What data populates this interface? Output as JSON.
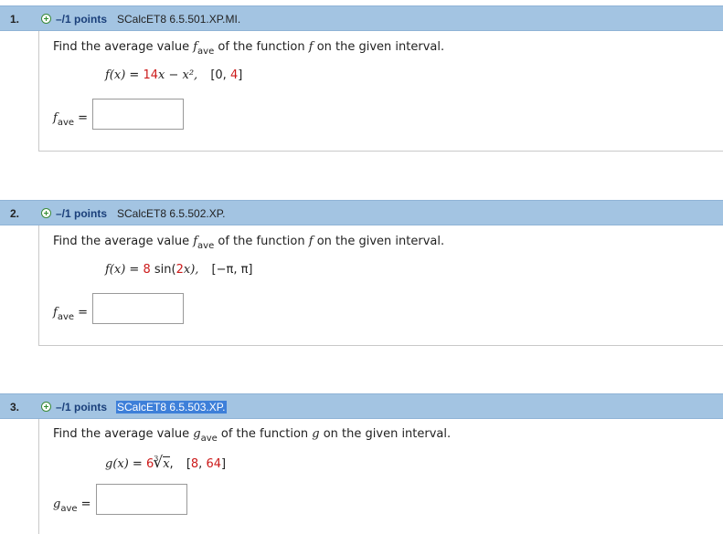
{
  "questions": [
    {
      "number": "1.",
      "points": "–/1 points",
      "ref": "SCalcET8 6.5.501.XP.MI.",
      "prompt_pre": "Find the average value ",
      "avg_var": "f",
      "avg_sub": "ave",
      "prompt_mid": " of the function ",
      "func_var": "f",
      "prompt_post": " on the given interval.",
      "formula_lhs": "f(x)",
      "formula_eq": " = ",
      "formula_rhs_a": "14",
      "formula_rhs_b": "x − x²,",
      "interval_open": "[0, ",
      "interval_val": "4",
      "interval_close": "]",
      "answer_label_var": "f",
      "answer_label_sub": "ave",
      "answer_eq": " =",
      "answer_value": ""
    },
    {
      "number": "2.",
      "points": "–/1 points",
      "ref": "SCalcET8 6.5.502.XP.",
      "prompt_pre": "Find the average value ",
      "avg_var": "f",
      "avg_sub": "ave",
      "prompt_mid": " of the function ",
      "func_var": "f",
      "prompt_post": " on the given interval.",
      "formula_lhs": "f(x)",
      "formula_eq": " = ",
      "formula_rhs_a": "8",
      "formula_rhs_b": " sin(",
      "formula_rhs_c": "2",
      "formula_rhs_d": "x),",
      "interval": "[−π, π]",
      "answer_label_var": "f",
      "answer_label_sub": "ave",
      "answer_eq": " =",
      "answer_value": ""
    },
    {
      "number": "3.",
      "points": "–/1 points",
      "ref": "SCalcET8 6.5.503.XP.",
      "prompt_pre": "Find the average value ",
      "avg_var": "g",
      "avg_sub": "ave",
      "prompt_mid": " of the function ",
      "func_var": "g",
      "prompt_post": " on the given interval.",
      "formula_lhs": "g(x)",
      "formula_eq": " = ",
      "formula_coef": "6",
      "root_index": "3",
      "root_arg": "x",
      "interval_open": "[",
      "interval_a": "8",
      "interval_sep": ", ",
      "interval_b": "64",
      "interval_close": "]",
      "answer_label_var": "g",
      "answer_label_sub": "ave",
      "answer_eq": " =",
      "answer_value": ""
    }
  ],
  "colors": {
    "header_bg": "#a3c4e2",
    "points_text": "#1a3f7a",
    "highlight": "#3d7fd9",
    "red_value": "#cc1a1a"
  },
  "icons": {
    "add": "plus-circle-icon"
  }
}
